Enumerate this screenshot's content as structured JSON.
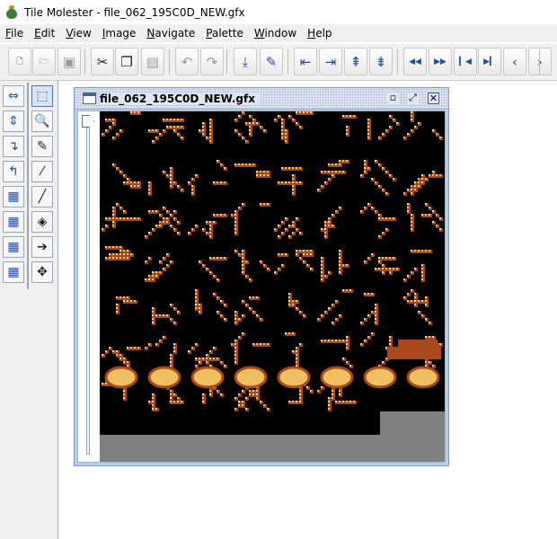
{
  "window": {
    "title": "Tile Molester - file_062_195C0D_NEW.gfx"
  },
  "menu": [
    {
      "mnemonic": "F",
      "rest": "ile"
    },
    {
      "mnemonic": "E",
      "rest": "dit"
    },
    {
      "mnemonic": "V",
      "rest": "iew"
    },
    {
      "mnemonic": "I",
      "rest": "mage"
    },
    {
      "mnemonic": "N",
      "rest": "avigate"
    },
    {
      "mnemonic": "P",
      "rest": "alette"
    },
    {
      "mnemonic": "W",
      "rest": "indow"
    },
    {
      "mnemonic": "H",
      "rest": "elp"
    }
  ],
  "toolbar": {
    "buttons": [
      {
        "name": "new-file-button",
        "icon": "new-file-icon",
        "glyph": "🗋",
        "style": "dark"
      },
      {
        "name": "open-button",
        "icon": "folder-icon",
        "glyph": "🗁",
        "style": "gold"
      },
      {
        "name": "save-button",
        "icon": "disk-icon",
        "glyph": "▣",
        "style": "dis"
      },
      {
        "name": "cut-button",
        "icon": "scissors-icon",
        "glyph": "✂",
        "style": "dark"
      },
      {
        "name": "copy-button",
        "icon": "copy-icon",
        "glyph": "❐",
        "style": "dark"
      },
      {
        "name": "paste-button",
        "icon": "clipboard-icon",
        "glyph": "▤",
        "style": "dis"
      },
      {
        "name": "undo-button",
        "icon": "undo-icon",
        "glyph": "↶",
        "style": "dis"
      },
      {
        "name": "redo-button",
        "icon": "redo-icon",
        "glyph": "↷",
        "style": "dis"
      },
      {
        "name": "go-to-button",
        "icon": "download-arrow-icon",
        "glyph": "⤓",
        "style": ""
      },
      {
        "name": "add-bookmark-button",
        "icon": "pencil-arrow-icon",
        "glyph": "✎",
        "style": ""
      },
      {
        "name": "decrease-width-button",
        "icon": "columns-left-icon",
        "glyph": "⇤",
        "style": ""
      },
      {
        "name": "increase-width-button",
        "icon": "columns-right-icon",
        "glyph": "⇥",
        "style": ""
      },
      {
        "name": "decrease-height-button",
        "icon": "rows-up-icon",
        "glyph": "⇞",
        "style": ""
      },
      {
        "name": "increase-height-button",
        "icon": "rows-down-icon",
        "glyph": "⇟",
        "style": ""
      },
      {
        "name": "page-back-button",
        "icon": "double-left-arrow-icon",
        "glyph": "◀◀",
        "style": ""
      },
      {
        "name": "page-forward-button",
        "icon": "double-right-arrow-icon",
        "glyph": "▶▶",
        "style": ""
      },
      {
        "name": "row-back-button",
        "icon": "bar-left-arrow-icon",
        "glyph": "▎◀",
        "style": ""
      },
      {
        "name": "row-forward-button",
        "icon": "bar-right-arrow-icon",
        "glyph": "▶▎",
        "style": ""
      },
      {
        "name": "tile-back-button",
        "icon": "chevron-left-icon",
        "glyph": "‹",
        "style": ""
      },
      {
        "name": "tile-forward-button",
        "icon": "chevron-right-icon",
        "glyph": "›",
        "style": ""
      }
    ]
  },
  "tools": {
    "left": [
      {
        "name": "move-tool",
        "icon": "horizontal-arrows-icon",
        "glyph": "⇔"
      },
      {
        "name": "vertical-move-tool",
        "icon": "vertical-arrows-icon",
        "glyph": "⇕"
      },
      {
        "name": "shift-down-tool",
        "icon": "arrow-down-right-icon",
        "glyph": "↴"
      },
      {
        "name": "shift-up-tool",
        "icon": "arrow-up-left-icon",
        "glyph": "↰"
      },
      {
        "name": "insert-column-tool",
        "icon": "grid-column-icon",
        "glyph": "▦"
      },
      {
        "name": "insert-row-tool",
        "icon": "grid-row-icon",
        "glyph": "▦"
      },
      {
        "name": "grid-up-tool",
        "icon": "grid-arrow-up-icon",
        "glyph": "▦"
      },
      {
        "name": "grid-down-tool",
        "icon": "grid-arrow-down-icon",
        "glyph": "▦"
      }
    ],
    "right": [
      {
        "name": "selection-tool",
        "icon": "selection-rectangle-icon",
        "glyph": "⬚",
        "selected": true
      },
      {
        "name": "zoom-tool",
        "icon": "magnifier-icon",
        "glyph": "🔍"
      },
      {
        "name": "pencil-tool",
        "icon": "pencil-icon",
        "glyph": "✎"
      },
      {
        "name": "dropper-tool",
        "icon": "eyedropper-icon",
        "glyph": "⁄"
      },
      {
        "name": "line-tool",
        "icon": "line-icon",
        "glyph": "╱"
      },
      {
        "name": "fill-tool",
        "icon": "paint-bucket-icon",
        "glyph": "◈"
      },
      {
        "name": "replace-color-tool",
        "icon": "replace-arrow-icon",
        "glyph": "➔"
      },
      {
        "name": "mover-tool",
        "icon": "four-way-arrow-icon",
        "glyph": "✥"
      }
    ]
  },
  "document": {
    "name": "file_062_195C0D_NEW.gfx",
    "controls": {
      "minimize_icon": "minimize-icon",
      "maximize_icon": "maximize-icon",
      "close_icon": "close-icon"
    }
  },
  "colors": {
    "canvas_bg": "#000000",
    "pixel_main": "#a8481c",
    "pixel_light": "#f0c060",
    "pixel_pale": "#f8e0a0",
    "padding_gray": "#808080"
  }
}
